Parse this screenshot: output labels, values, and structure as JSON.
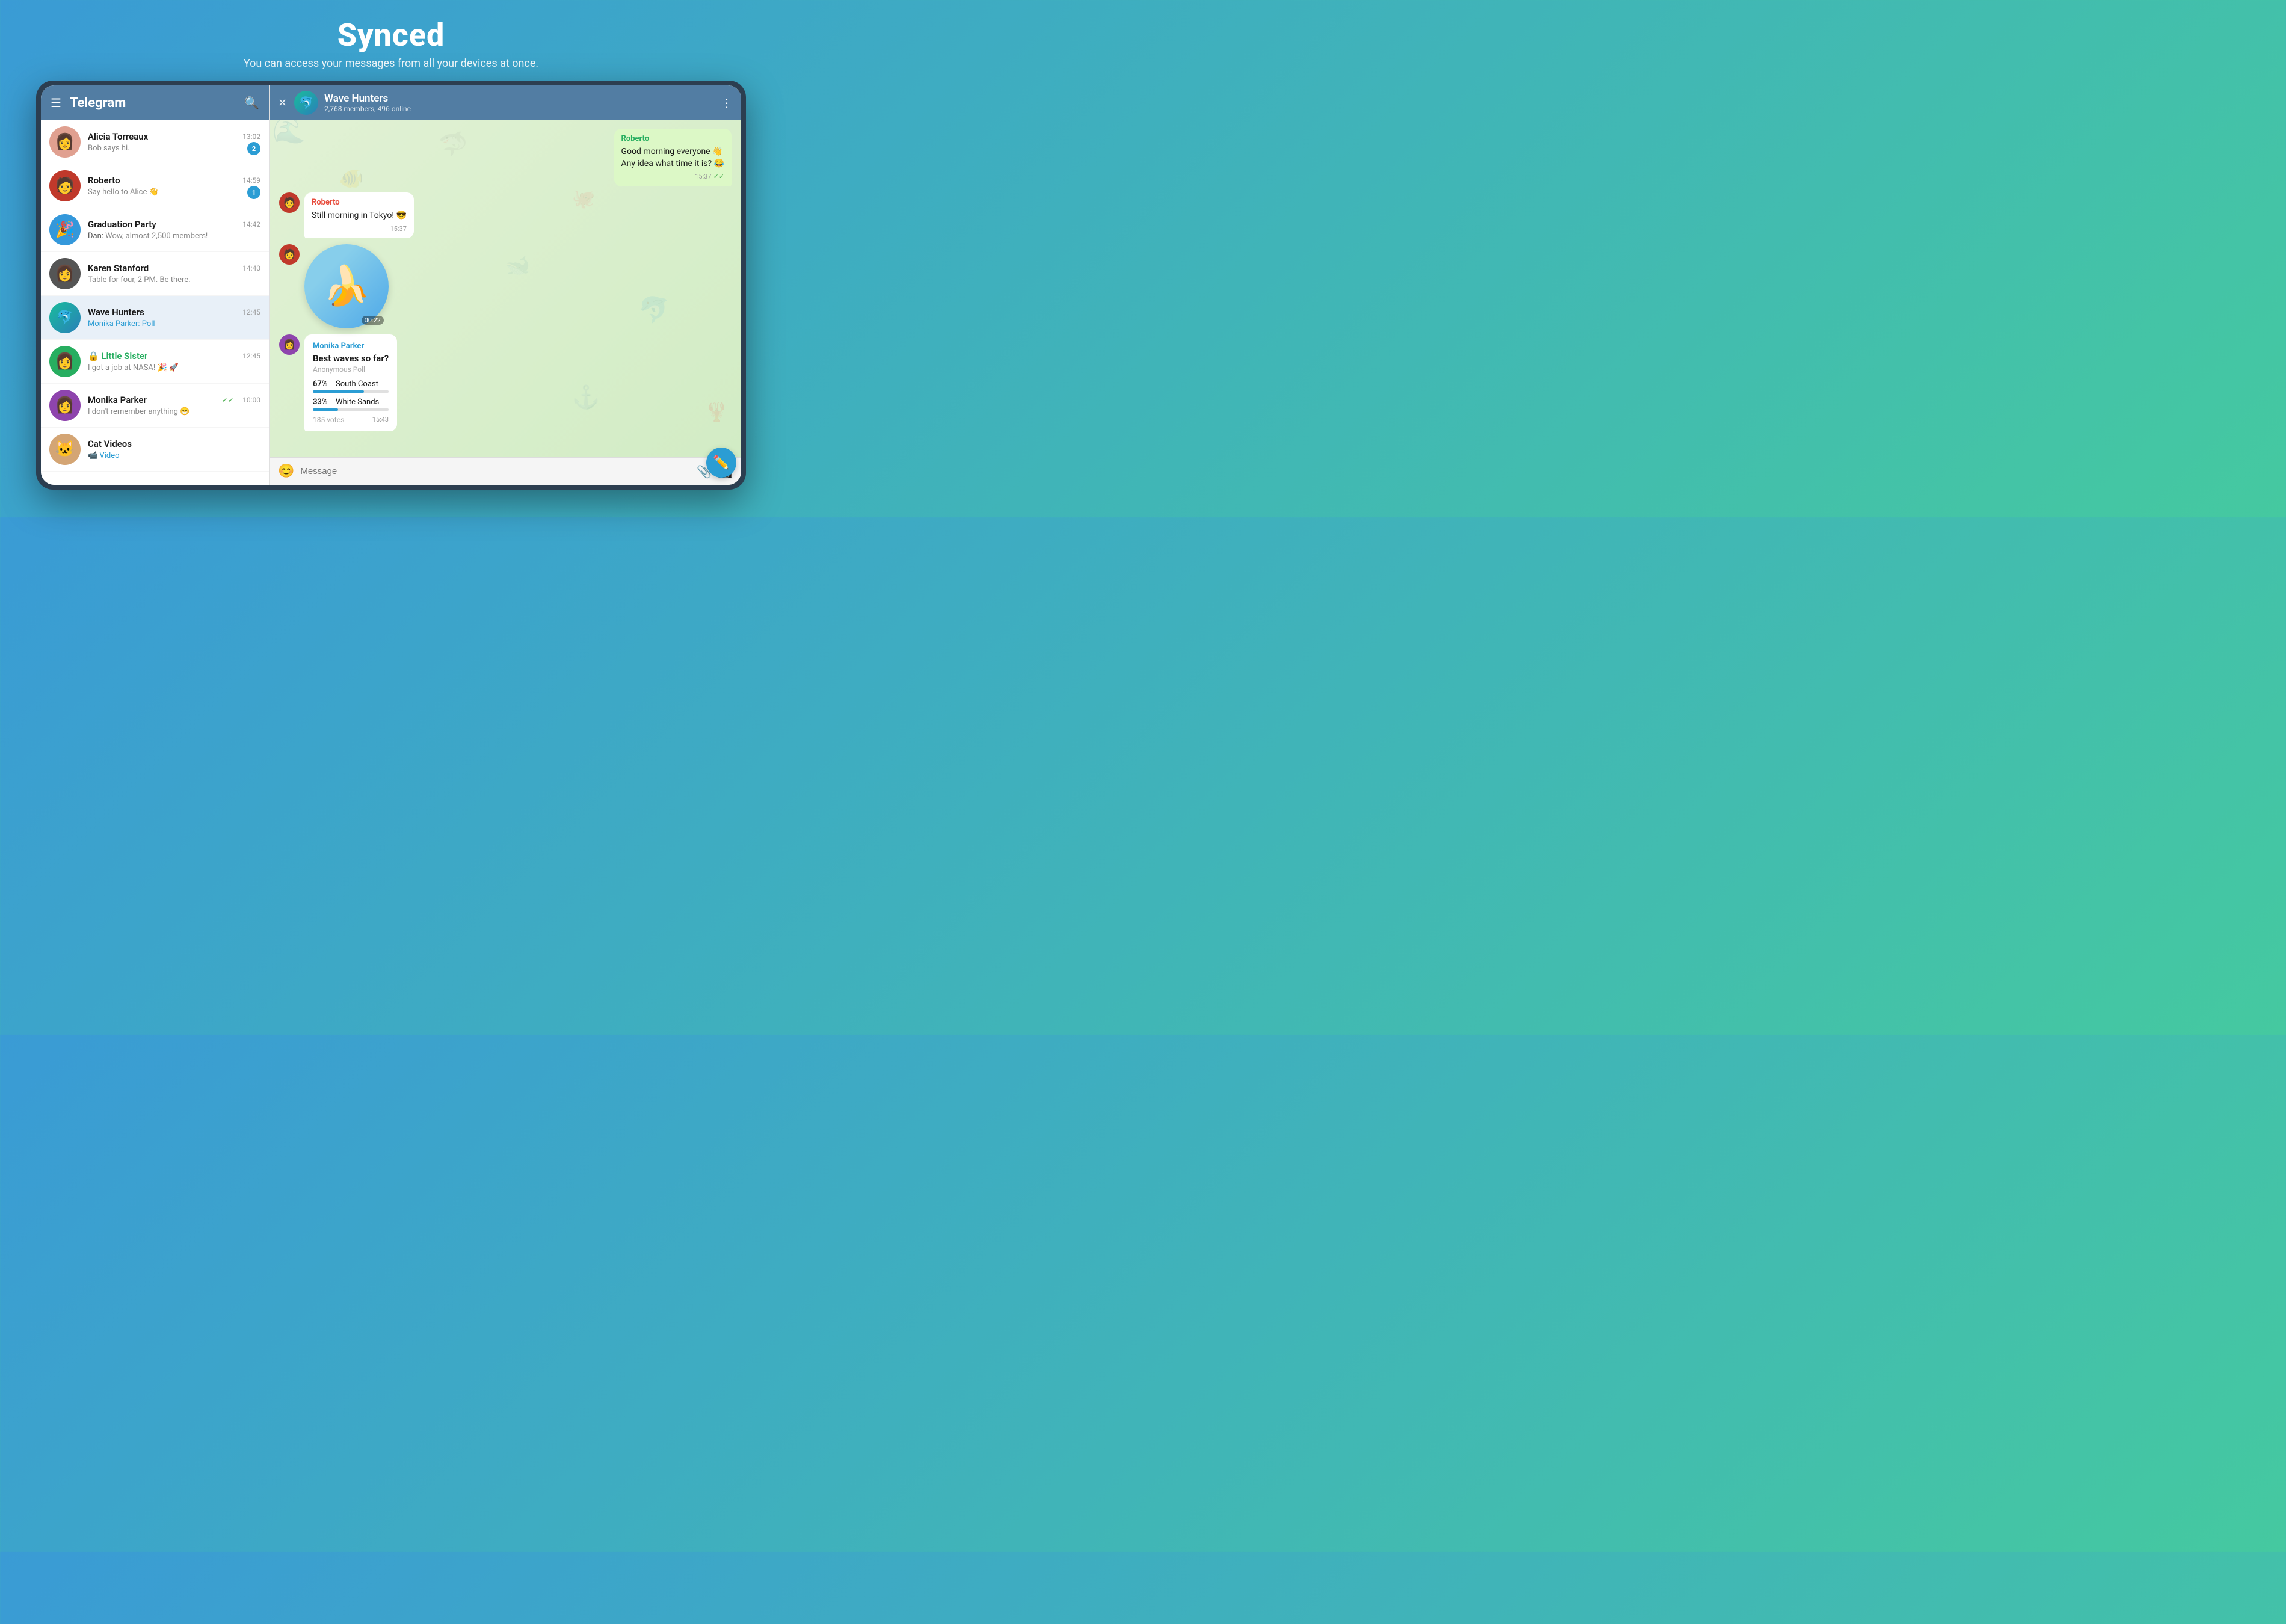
{
  "page": {
    "title": "Synced",
    "subtitle": "You can access your messages from all your devices at once."
  },
  "sidebar": {
    "header": {
      "title": "Telegram",
      "menu_icon": "☰",
      "search_icon": "🔍"
    },
    "chats": [
      {
        "id": "alicia",
        "name": "Alicia Torreaux",
        "time": "13:02",
        "preview": "Bob says hi.",
        "badge": "2",
        "avatar_color": "#e8b4a0",
        "avatar_emoji": "👩"
      },
      {
        "id": "roberto",
        "name": "Roberto",
        "time": "14:59",
        "preview": "Say hello to Alice 👋",
        "badge": "1",
        "avatar_color": "#c0392b",
        "avatar_emoji": "🧑"
      },
      {
        "id": "graduation",
        "name": "Graduation Party",
        "time": "14:42",
        "preview_sender": "Dan:",
        "preview": " Wow, almost 2,500 members!",
        "badge": "",
        "avatar_color": "#3498db",
        "avatar_emoji": "🎉"
      },
      {
        "id": "karen",
        "name": "Karen Stanford",
        "time": "14:40",
        "preview": "Table for four, 2 PM. Be there.",
        "badge": "",
        "avatar_color": "#2c3e50",
        "avatar_emoji": "👩"
      },
      {
        "id": "wavehunters",
        "name": "Wave Hunters",
        "time": "12:45",
        "preview_highlight": "Monika Parker: Poll",
        "badge": "",
        "avatar_color": "#1abc9c",
        "avatar_emoji": "🌊",
        "active": true
      },
      {
        "id": "littlesister",
        "name": "🔒 Little Sister",
        "time": "12:45",
        "preview": "I got a job at NASA! 🎉 🚀",
        "badge": "",
        "avatar_color": "#27ae60",
        "avatar_emoji": "👩",
        "name_green": true
      },
      {
        "id": "monika",
        "name": "Monika Parker",
        "time": "10:00",
        "preview": "I don't remember anything 😁",
        "badge": "",
        "avatar_color": "#8e44ad",
        "avatar_emoji": "👩",
        "read": true
      },
      {
        "id": "catvideos",
        "name": "Cat Videos",
        "time": "",
        "preview": "📹 Video",
        "badge": "",
        "avatar_color": "#e67e22",
        "avatar_emoji": "🐱"
      }
    ],
    "compose_icon": "✏️"
  },
  "chat": {
    "header": {
      "group_name": "Wave Hunters",
      "members": "2,768 members, 496 online",
      "close_icon": "✕",
      "more_icon": "⋮"
    },
    "messages": [
      {
        "id": "msg1",
        "side": "right",
        "sender": "Roberto",
        "text": "Good morning everyone 👋\nAny idea what time it is? 😂",
        "time": "15:37",
        "ticks": "✓✓"
      },
      {
        "id": "msg2",
        "side": "left",
        "sender": "Roberto",
        "text": "Still morning in Tokyo! 😎",
        "time": "15:37"
      },
      {
        "id": "msg3",
        "side": "left",
        "type": "sticker",
        "emoji": "🍌",
        "duration": "00:22"
      },
      {
        "id": "msg4",
        "side": "left",
        "type": "poll",
        "sender": "Monika Parker",
        "question": "Best waves so far?",
        "poll_type": "Anonymous Poll",
        "options": [
          {
            "label": "South Coast",
            "pct": 67,
            "pct_text": "67%"
          },
          {
            "label": "White Sands",
            "pct": 33,
            "pct_text": "33%"
          }
        ],
        "votes": "185 votes",
        "time": "15:43"
      }
    ],
    "input": {
      "placeholder": "Message",
      "emoji_icon": "😊",
      "attach_icon": "📎",
      "camera_icon": "📷"
    }
  }
}
